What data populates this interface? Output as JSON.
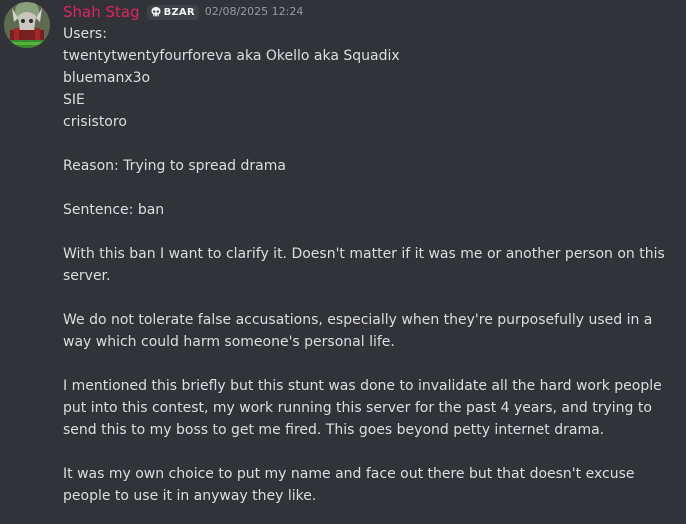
{
  "message": {
    "author": "Shah Stag",
    "author_color": "#e0245e",
    "tag_icon": "skull-icon",
    "tag": "BZAR",
    "timestamp": "02/08/2025 12:24",
    "content": {
      "users_heading": "Users:",
      "users": [
        "twentytwentyfourforeva aka Okello aka Squadix",
        "bluemanx3o",
        "SIE",
        "crisistoro"
      ],
      "reason": "Reason: Trying to spread drama",
      "sentence": "Sentence: ban",
      "paragraphs": [
        "With this ban I want to clarify it. Doesn't matter if it was me or another person on this server.",
        "We do not tolerate false accusations, especially when they're purposefully used in a way which could harm someone's personal life.",
        "I mentioned this briefly but this stunt was done to invalidate all the hard work people put into this contest, my work running this server for the past 4 years, and trying to send this to my boss to get me fired. This goes beyond petty internet drama.",
        "It was my own choice to put my name and face out there but that doesn't excuse people to use it in anyway they like."
      ]
    }
  },
  "colors": {
    "background": "#313338",
    "text": "#dbdee1",
    "muted": "#949ba4",
    "tag_background": "#3f4147"
  }
}
